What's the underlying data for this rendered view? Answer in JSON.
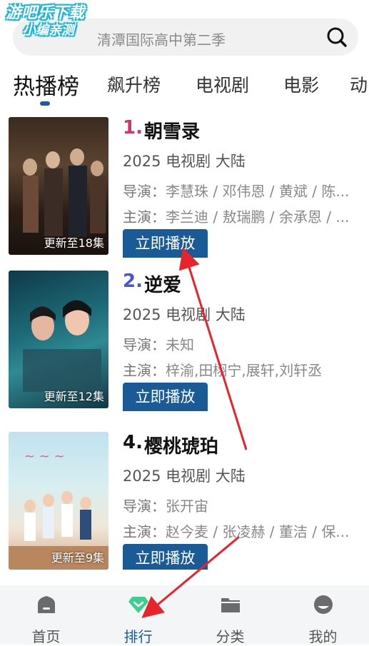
{
  "watermark": {
    "line1": "游吧乐下载",
    "line2": "小编亲测"
  },
  "search": {
    "placeholder": "清潭国际高中第二季",
    "icon": "search-icon"
  },
  "tabs": [
    {
      "label": "热播榜",
      "active": true
    },
    {
      "label": "飙升榜",
      "active": false
    },
    {
      "label": "电视剧",
      "active": false
    },
    {
      "label": "电影",
      "active": false
    },
    {
      "label": "动",
      "active": false
    }
  ],
  "items": [
    {
      "rank": "1.",
      "rank_color": "#d6336c",
      "title": "朝雪录",
      "meta": "2025 电视剧 大陆",
      "director_label": "导演：",
      "director": "李慧珠 / 邓伟恩 / 黄斌 / 陈...",
      "cast_label": "主演：",
      "cast": "李兰迪 / 敖瑞鹏 / 余承恩 / ...",
      "badge": "更新至18集",
      "play_label": "立即播放"
    },
    {
      "rank": "2.",
      "rank_color": "#4a55d6",
      "title": "逆爱",
      "meta": "2025 电视剧 大陆",
      "director_label": "导演：",
      "director": "未知",
      "cast_label": "主演：",
      "cast": "梓渝,田栩宁,展轩,刘轩丞",
      "badge": "更新至12集",
      "play_label": "立即播放"
    },
    {
      "rank": "4.",
      "rank_color": "#111111",
      "title": "樱桃琥珀",
      "meta": "2025 电视剧 大陆",
      "director_label": "导演：",
      "director": "张开宙",
      "cast_label": "主演：",
      "cast": "赵今麦 / 张凌赫 / 董洁 / 保...",
      "badge": "更新至9集",
      "play_label": "立即播放"
    }
  ],
  "nav": [
    {
      "label": "首页",
      "icon": "home-icon",
      "active": false
    },
    {
      "label": "排行",
      "icon": "ranking-icon",
      "active": true
    },
    {
      "label": "分类",
      "icon": "folder-icon",
      "active": false
    },
    {
      "label": "我的",
      "icon": "profile-icon",
      "active": false
    }
  ],
  "colors": {
    "accent": "#1a5a96",
    "annotation_arrow": "#e8232a",
    "ranking_icon": "#3ecf8e"
  }
}
